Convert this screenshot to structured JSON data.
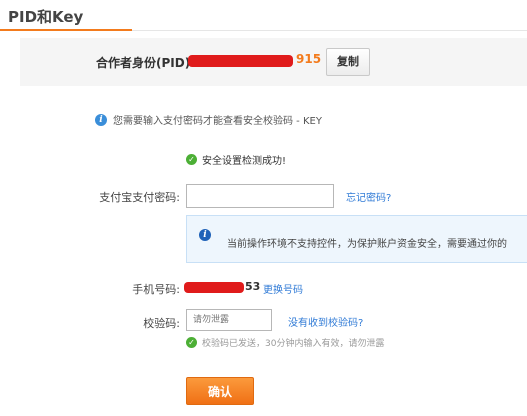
{
  "header": {
    "title": "PID和Key"
  },
  "pid": {
    "label": "合作者身份(PID)",
    "suffix": "915",
    "copy_label": "复制"
  },
  "info": {
    "text": "您需要输入支付密码才能查看安全校验码 - KEY"
  },
  "security_check": {
    "text": "安全设置检测成功!"
  },
  "password": {
    "label": "支付宝支付密码:",
    "forgot_link": "忘记密码?"
  },
  "warning": {
    "text": "当前操作环境不支持控件，为保护账户资金安全，需要通过你的"
  },
  "phone": {
    "label": "手机号码:",
    "suffix": "53",
    "change_link": "更换号码"
  },
  "code": {
    "label": "校验码:",
    "placeholder": "请勿泄露",
    "no_code_link": "没有收到校验码?",
    "sent_text": "校验码已发送，30分钟内输入有效，请勿泄露"
  },
  "confirm_label": "确认",
  "colors": {
    "accent": "#f37b1d",
    "link": "#2f7ad6",
    "success": "#4caf35",
    "redaction": "#e01b1b"
  }
}
